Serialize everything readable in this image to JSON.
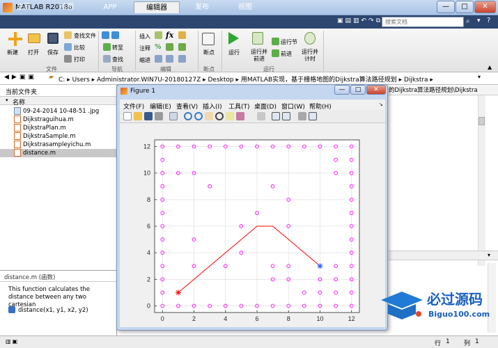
{
  "app": {
    "title": "MATLAB R2018a"
  },
  "window_controls": {
    "minimize": "—",
    "maximize": "□",
    "close": "✕"
  },
  "tabs": [
    {
      "label": "主页"
    },
    {
      "label": "绘图"
    },
    {
      "label": "APP"
    },
    {
      "label": "编辑器",
      "active": true
    },
    {
      "label": "发布"
    },
    {
      "label": "视图"
    }
  ],
  "search": {
    "placeholder": "搜索文档"
  },
  "ribbon": {
    "file_group": {
      "label": "文件",
      "new": "新建",
      "open": "打开",
      "save": "保存",
      "find_files": "查找文件",
      "compare": "比较",
      "print": "打印"
    },
    "nav_group": {
      "label": "导航",
      "goto": "转至",
      "find": "查找"
    },
    "edit_group": {
      "label": "编辑",
      "insert": "插入",
      "comment": "注释",
      "indent": "缩进",
      "fx": "fx"
    },
    "breakpoint_group": {
      "label": "断点",
      "breakpoint": "断点"
    },
    "run_group": {
      "label": "运行",
      "run": "运行",
      "run_advance": "运行并前进",
      "run_section": "运行节",
      "advance": "前进",
      "run_time": "运行并计时"
    }
  },
  "address": {
    "segments": [
      "C:",
      "Users",
      "Administrator.WIN7U-20180127Z",
      "Desktop",
      "用MATLAB实现，基于栅格地图的Dijkstra算法路径规划",
      "Dijkstra"
    ],
    "right_fragment": "的Dijkstra算法路径规划\\Dijkstra"
  },
  "current_folder": {
    "title": "当前文件夹",
    "column": "名称",
    "files": [
      {
        "name": "09-24-2014 10-48-51 .jpg"
      },
      {
        "name": "Dijkstraguihua.m"
      },
      {
        "name": "DijkstraPlan.m"
      },
      {
        "name": "DijkstraSample.m"
      },
      {
        "name": "Dijkstrasampleyichu.m"
      },
      {
        "name": "distance.m",
        "selected": true
      }
    ]
  },
  "details": {
    "title": "distance.m  (函数)",
    "description": "This function calculates the distance between any two cartesian",
    "signature": "distance(x1, y1, x2, y2)"
  },
  "figure": {
    "title": "Figure 1",
    "menu": [
      "文件(F)",
      "编辑(E)",
      "查看(V)",
      "插入(I)",
      "工具(T)",
      "桌面(D)",
      "窗口(W)",
      "帮助(H)"
    ]
  },
  "statusbar": {
    "row_label": "行",
    "row": "1",
    "col_label": "列",
    "col": "1"
  },
  "logo": {
    "text": "必过源码",
    "sub": "Biguo100.com"
  },
  "chart_data": {
    "type": "scatter",
    "xlim": [
      -0.5,
      12.5
    ],
    "ylim": [
      -0.5,
      12.5
    ],
    "xticks": [
      0,
      2,
      4,
      6,
      8,
      10,
      12
    ],
    "yticks": [
      0,
      2,
      4,
      6,
      8,
      10,
      12
    ],
    "grid": true,
    "obstacles": [
      [
        0,
        0
      ],
      [
        1,
        0
      ],
      [
        2,
        0
      ],
      [
        3,
        0
      ],
      [
        4,
        0
      ],
      [
        5,
        0
      ],
      [
        6,
        0
      ],
      [
        7,
        0
      ],
      [
        8,
        0
      ],
      [
        9,
        0
      ],
      [
        10,
        0
      ],
      [
        11,
        0
      ],
      [
        12,
        0
      ],
      [
        0,
        12
      ],
      [
        1,
        12
      ],
      [
        2,
        12
      ],
      [
        3,
        12
      ],
      [
        4,
        12
      ],
      [
        5,
        12
      ],
      [
        6,
        12
      ],
      [
        7,
        12
      ],
      [
        8,
        12
      ],
      [
        9,
        12
      ],
      [
        10,
        12
      ],
      [
        11,
        12
      ],
      [
        12,
        12
      ],
      [
        0,
        1
      ],
      [
        0,
        2
      ],
      [
        0,
        3
      ],
      [
        0,
        4
      ],
      [
        0,
        5
      ],
      [
        0,
        6
      ],
      [
        0,
        7
      ],
      [
        0,
        8
      ],
      [
        0,
        9
      ],
      [
        0,
        10
      ],
      [
        0,
        11
      ],
      [
        12,
        1
      ],
      [
        12,
        2
      ],
      [
        12,
        3
      ],
      [
        12,
        4
      ],
      [
        12,
        5
      ],
      [
        12,
        6
      ],
      [
        12,
        7
      ],
      [
        12,
        8
      ],
      [
        12,
        9
      ],
      [
        12,
        10
      ],
      [
        12,
        11
      ],
      [
        1,
        10
      ],
      [
        2,
        10
      ],
      [
        11,
        10
      ],
      [
        11,
        11
      ],
      [
        3,
        9
      ],
      [
        7,
        9
      ],
      [
        8,
        8
      ],
      [
        6,
        7
      ],
      [
        5,
        6
      ],
      [
        2,
        5
      ],
      [
        8,
        6
      ],
      [
        5,
        4
      ],
      [
        2,
        3
      ],
      [
        4,
        3
      ],
      [
        7,
        3
      ],
      [
        8,
        3
      ],
      [
        11,
        3
      ],
      [
        7,
        2
      ],
      [
        8,
        2
      ],
      [
        10,
        2
      ],
      [
        11,
        2
      ],
      [
        9,
        1
      ],
      [
        10,
        1
      ],
      [
        11,
        1
      ]
    ],
    "path": [
      [
        1,
        1
      ],
      [
        6,
        6
      ],
      [
        7,
        6
      ],
      [
        10,
        3
      ]
    ],
    "start": [
      1,
      1
    ],
    "goal": [
      10,
      3
    ],
    "obstacle_color": "#ff00ff",
    "path_color": "#ff0000",
    "goal_color": "#1f4fff"
  }
}
